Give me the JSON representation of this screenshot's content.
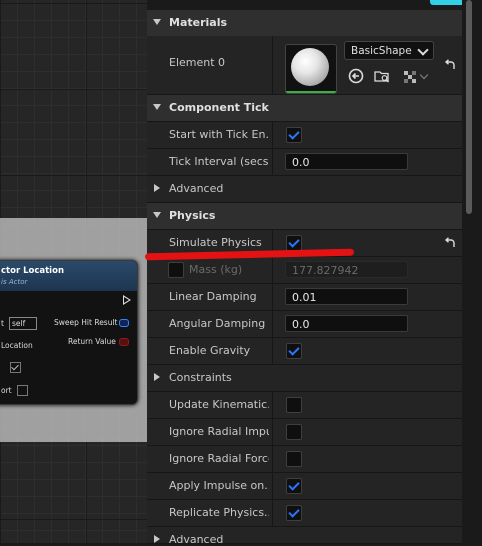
{
  "graph_node": {
    "title": "ctor Location",
    "subtitle": "is Actor",
    "target_label": "t",
    "target_value": "self",
    "location_label": "Location",
    "sweep_label": "Sweep Hit Result",
    "return_label": "Return Value",
    "port_label": "ort"
  },
  "details": {
    "materials": {
      "category": "Materials",
      "element_label": "Element 0",
      "material_name": "BasicShape"
    },
    "component_tick": {
      "category": "Component Tick",
      "start_with_tick_label": "Start with Tick En...",
      "start_with_tick_checked": true,
      "tick_interval_label": "Tick Interval (secs)",
      "tick_interval_value": "0.0",
      "advanced_label": "Advanced"
    },
    "physics": {
      "category": "Physics",
      "simulate_label": "Simulate Physics",
      "simulate_checked": true,
      "mass_label": "Mass (kg)",
      "mass_value": "177.827942",
      "linear_damping_label": "Linear Damping",
      "linear_damping_value": "0.01",
      "angular_damping_label": "Angular Damping",
      "angular_damping_value": "0.0",
      "enable_gravity_label": "Enable Gravity",
      "enable_gravity_checked": true,
      "constraints_label": "Constraints",
      "update_kinematic_label": "Update Kinematic...",
      "update_kinematic_checked": false,
      "ignore_radial_impulse_label": "Ignore Radial Impu...",
      "ignore_radial_impulse_checked": false,
      "ignore_radial_force_label": "Ignore Radial Force",
      "ignore_radial_force_checked": false,
      "apply_impulse_label": "Apply Impulse on...",
      "apply_impulse_checked": true,
      "replicate_physics_label": "Replicate Physics...",
      "replicate_physics_checked": true,
      "advanced_label": "Advanced"
    }
  },
  "colors": {
    "accent_check": "#2a74ff",
    "annotation_red": "#e41212",
    "material_bar": "#3cb043"
  }
}
